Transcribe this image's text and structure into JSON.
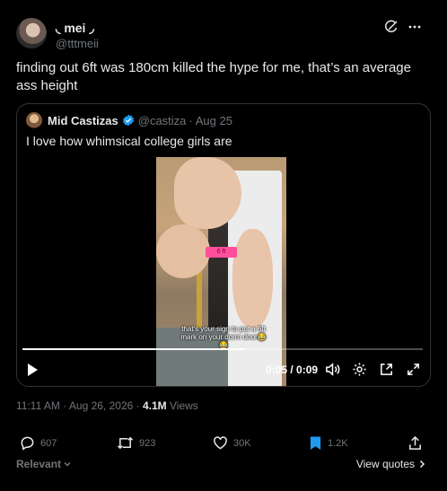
{
  "tweet": {
    "author_name": "mei",
    "name_emoji_left": "◟",
    "name_emoji_right": "◞",
    "author_handle": "@tttmeii",
    "text": "finding out 6ft was 180cm killed the hype for me, that’s an average ass height",
    "timestamp": "11:11 AM · Aug 26, 2026 · ",
    "views_count": "4.1M",
    "views_label": " Views"
  },
  "quoted": {
    "author_name": "Mid Castizas",
    "author_handle": "@castiza",
    "separator": "·",
    "date": "Aug 25",
    "text": "I love how whimsical college girls are",
    "video": {
      "caption": "that's your sign to put a 6ft mark on your dorm door😂😂",
      "tape_label": "6 ft",
      "current_time": "0:05",
      "duration": "0:09",
      "progress_fraction": 0.556
    }
  },
  "actions": {
    "replies": "607",
    "reposts": "923",
    "likes": "30K",
    "bookmarks": "1.2K"
  },
  "footer": {
    "sort_label": "Relevant",
    "view_quotes": "View quotes"
  },
  "colors": {
    "background": "#000000",
    "text": "#e7e9ea",
    "muted": "#71767b",
    "verified": "#1d9bf0",
    "bookmark_active": "#1d9bf0"
  }
}
